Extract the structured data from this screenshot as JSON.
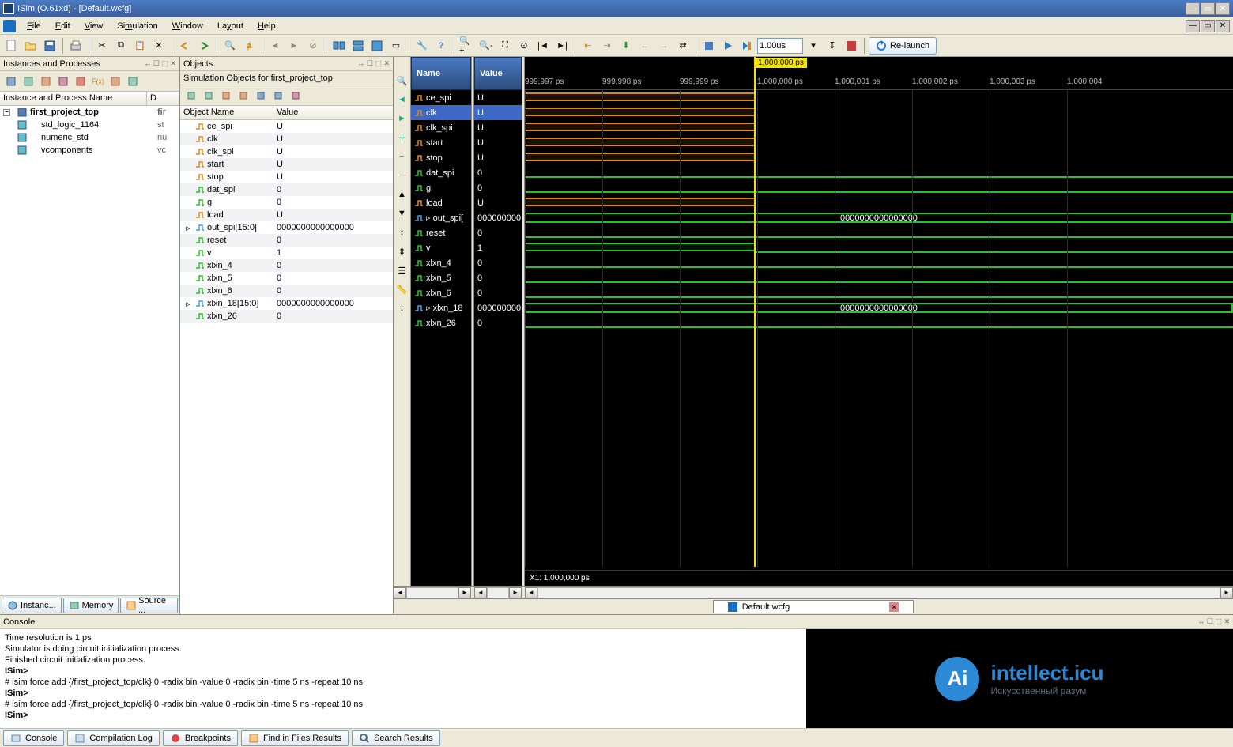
{
  "title": "ISim (O.61xd) - [Default.wcfg]",
  "menus": {
    "file": "File",
    "edit": "Edit",
    "view": "View",
    "simulation": "Simulation",
    "window": "Window",
    "layout": "Layout",
    "help": "Help"
  },
  "toolbar": {
    "time_value": "1.00us",
    "relaunch": "Re-launch"
  },
  "panels": {
    "instances": {
      "title": "Instances and Processes",
      "col_name": "Instance and Process Name",
      "col_d": "D"
    },
    "objects": {
      "title": "Objects",
      "subtitle": "Simulation Objects for first_project_top",
      "col_name": "Object Name",
      "col_value": "Value"
    }
  },
  "instance_tree": [
    {
      "label": "first_project_top",
      "d": "fir",
      "bold": true
    },
    {
      "label": "std_logic_1164",
      "d": "st"
    },
    {
      "label": "numeric_std",
      "d": "nu"
    },
    {
      "label": "vcomponents",
      "d": "vc"
    }
  ],
  "bottom_tabs_left": [
    {
      "label": "Instanc..."
    },
    {
      "label": "Memory"
    },
    {
      "label": "Source ..."
    }
  ],
  "sim_objects": [
    {
      "name": "ce_spi",
      "value": "U",
      "c": "o"
    },
    {
      "name": "clk",
      "value": "U",
      "c": "o"
    },
    {
      "name": "clk_spi",
      "value": "U",
      "c": "o"
    },
    {
      "name": "start",
      "value": "U",
      "c": "o"
    },
    {
      "name": "stop",
      "value": "U",
      "c": "o"
    },
    {
      "name": "dat_spi",
      "value": "0",
      "c": "g"
    },
    {
      "name": "g",
      "value": "0",
      "c": "g"
    },
    {
      "name": "load",
      "value": "U",
      "c": "o"
    },
    {
      "name": "out_spi[15:0]",
      "value": "0000000000000000",
      "c": "b"
    },
    {
      "name": "reset",
      "value": "0",
      "c": "g"
    },
    {
      "name": "v",
      "value": "1",
      "c": "g"
    },
    {
      "name": "xlxn_4",
      "value": "0",
      "c": "g"
    },
    {
      "name": "xlxn_5",
      "value": "0",
      "c": "g"
    },
    {
      "name": "xlxn_6",
      "value": "0",
      "c": "g"
    },
    {
      "name": "xlxn_18[15:0]",
      "value": "0000000000000000",
      "c": "b"
    },
    {
      "name": "xlxn_26",
      "value": "0",
      "c": "g"
    }
  ],
  "wave": {
    "name_hdr": "Name",
    "value_hdr": "Value",
    "marker_badge": "1,000,000 ps",
    "cursor_label": "X1: 1,000,000 ps",
    "ticks": [
      "999,997 ps",
      "999,998 ps",
      "999,999 ps",
      "1,000,000 ps",
      "1,000,001 ps",
      "1,000,002 ps",
      "1,000,003 ps",
      "1,000,004"
    ],
    "signals": [
      {
        "name": "ce_spi",
        "value": "U",
        "t": "orange"
      },
      {
        "name": "clk",
        "value": "U",
        "t": "orange",
        "sel": true
      },
      {
        "name": "clk_spi",
        "value": "U",
        "t": "orange"
      },
      {
        "name": "start",
        "value": "U",
        "t": "orange"
      },
      {
        "name": "stop",
        "value": "U",
        "t": "orange"
      },
      {
        "name": "dat_spi",
        "value": "0",
        "t": "green_lo"
      },
      {
        "name": "g",
        "value": "0",
        "t": "green_lo"
      },
      {
        "name": "load",
        "value": "U",
        "t": "orange"
      },
      {
        "name": "out_spi[",
        "value": "000000000",
        "t": "bus",
        "bus": "0000000000000000"
      },
      {
        "name": "reset",
        "value": "0",
        "t": "green_lo"
      },
      {
        "name": "v",
        "value": "1",
        "t": "green_hi"
      },
      {
        "name": "xlxn_4",
        "value": "0",
        "t": "green_lo"
      },
      {
        "name": "xlxn_5",
        "value": "0",
        "t": "green_lo"
      },
      {
        "name": "xlxn_6",
        "value": "0",
        "t": "green_lo"
      },
      {
        "name": "xlxn_18",
        "value": "000000000",
        "t": "bus",
        "bus": "0000000000000000"
      },
      {
        "name": "xlxn_26",
        "value": "0",
        "t": "green_lo"
      }
    ]
  },
  "file_tab": "Default.wcfg",
  "console": {
    "title": "Console",
    "lines": [
      "Time resolution is 1 ps",
      "Simulator is doing circuit initialization process.",
      "Finished circuit initialization process.",
      "ISim>",
      "# isim force add {/first_project_top/clk} 0 -radix bin -value 0 -radix bin -time 5 ns -repeat 10 ns",
      "ISim>",
      "# isim force add {/first_project_top/clk} 0 -radix bin -value 0 -radix bin -time 5 ns -repeat 10 ns",
      "ISim>"
    ],
    "tabs": [
      "Console",
      "Compilation Log",
      "Breakpoints",
      "Find in Files Results",
      "Search Results"
    ]
  },
  "brand": {
    "main": "intellect.icu",
    "sub": "Искусственный разум"
  }
}
